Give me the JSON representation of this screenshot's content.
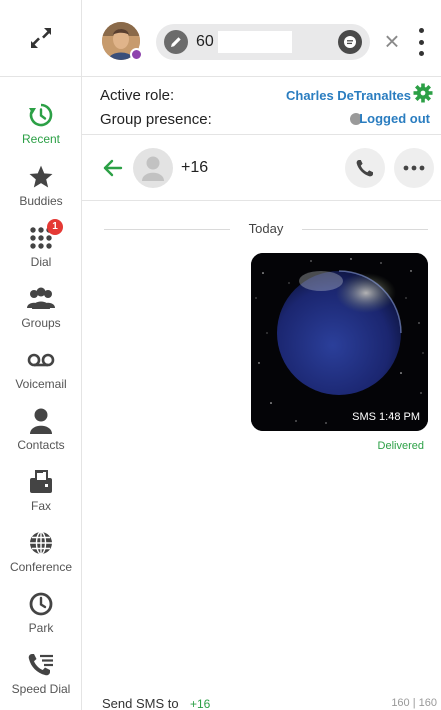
{
  "sidebar": {
    "items": [
      {
        "label": "Recent",
        "icon": "recent-clock-icon",
        "active": true
      },
      {
        "label": "Buddies",
        "icon": "star-icon"
      },
      {
        "label": "Dial",
        "icon": "dialpad-icon",
        "badge": "1"
      },
      {
        "label": "Groups",
        "icon": "groups-icon"
      },
      {
        "label": "Voicemail",
        "icon": "voicemail-icon"
      },
      {
        "label": "Contacts",
        "icon": "contact-person-icon"
      },
      {
        "label": "Fax",
        "icon": "fax-icon"
      },
      {
        "label": "Conference",
        "icon": "globe-icon"
      },
      {
        "label": "Park",
        "icon": "park-clock-icon"
      },
      {
        "label": "Speed Dial",
        "icon": "speed-dial-icon"
      }
    ]
  },
  "header": {
    "search_value": "60"
  },
  "role_panel": {
    "active_role_label": "Active role:",
    "active_role_value": "Charles DeTranaltes",
    "group_presence_label": "Group presence:",
    "group_presence_value": "Logged out"
  },
  "conversation": {
    "contact_number": "+16"
  },
  "messages": {
    "day_separator": "Today",
    "items": [
      {
        "type": "mms-image",
        "image": "earth-in-space",
        "time": "SMS 1:48 PM",
        "status": "Delivered"
      }
    ]
  },
  "composer": {
    "send_label": "Send SMS to",
    "send_number": "+16",
    "char_count": "160 | 160"
  },
  "colors": {
    "accent_green": "#2ca046",
    "link_blue": "#2a7dc0",
    "badge_red": "#e53935",
    "presence_purple": "#8e44ad"
  }
}
